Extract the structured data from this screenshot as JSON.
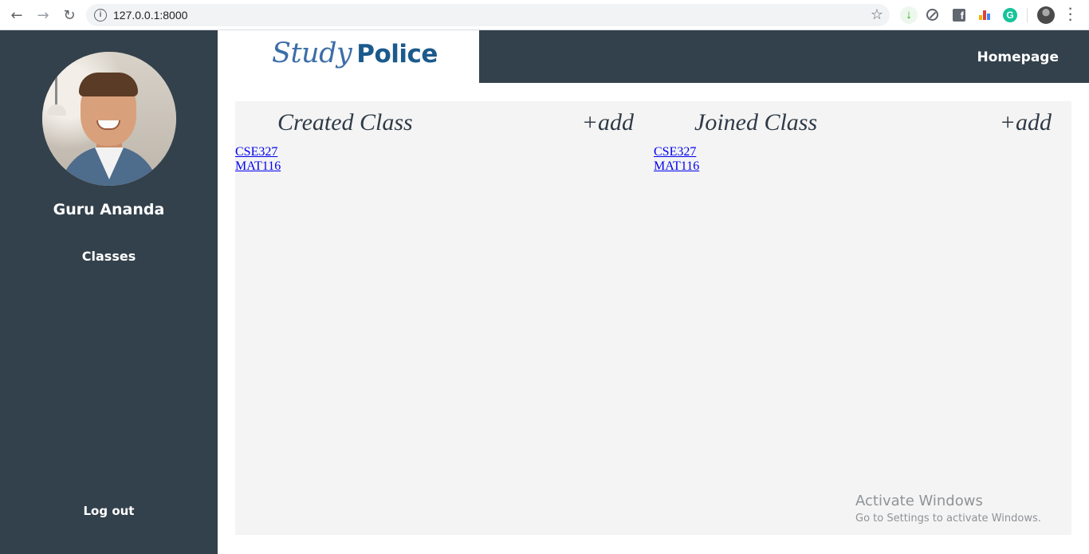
{
  "browser": {
    "url": "127.0.0.1:8000",
    "icons": {
      "back": "arrow-left-icon",
      "forward": "arrow-right-icon",
      "reload": "reload-icon",
      "site_info": "info-icon",
      "bookmark": "star-icon",
      "menu": "kebab-menu-icon"
    },
    "extensions": [
      "download-extension-icon",
      "blocker-extension-icon",
      "facebook-extension-icon",
      "bars-extension-icon",
      "grammarly-extension-icon",
      "profile-avatar-icon"
    ]
  },
  "logo": {
    "part1": "Study",
    "part2": "Police"
  },
  "header": {
    "homepage_label": "Homepage"
  },
  "sidebar": {
    "user_name": "Guru Ananda",
    "nav_classes": "Classes",
    "logout": "Log out"
  },
  "created": {
    "title": "Created Class",
    "add_label": "+add",
    "classes": [
      "CSE327",
      "MAT116"
    ]
  },
  "joined": {
    "title": "Joined Class",
    "add_label": "+add",
    "classes": [
      "CSE327",
      "MAT116"
    ]
  },
  "watermark": {
    "line1": "Activate Windows",
    "line2": "Go to Settings to activate Windows."
  },
  "colors": {
    "sidebar_bg": "#33414c",
    "panel_bg": "#f4f4f4",
    "link": "#0000ee",
    "logo_blue": "#3b6ea8"
  }
}
